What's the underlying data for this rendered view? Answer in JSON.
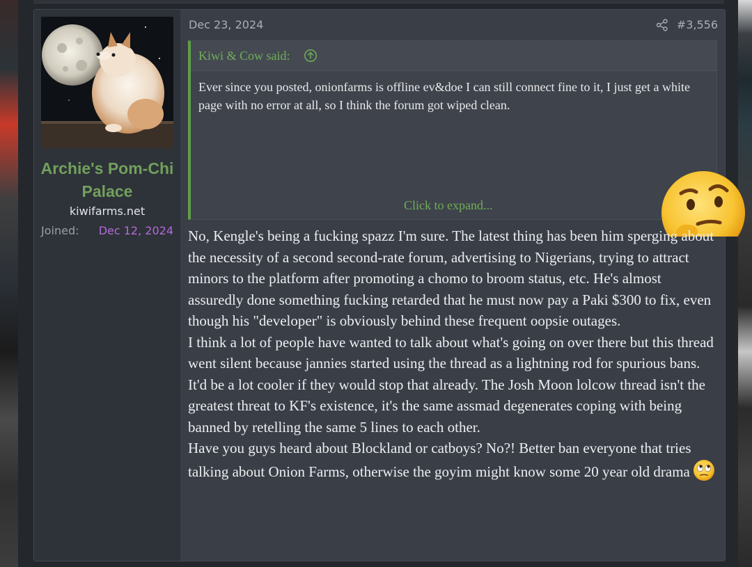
{
  "user": {
    "name": "Archie's Pom-Chi Palace",
    "title": "kiwifarms.net",
    "joined_label": "Joined:",
    "joined_date": "Dec 12, 2024"
  },
  "post": {
    "date": "Dec 23, 2024",
    "number": "#3,556",
    "share_icon": "share-icon"
  },
  "quote": {
    "author": "Kiwi & Cow said:",
    "jump_icon": "arrow-up-circle-icon",
    "text": "Ever since you posted, onionfarms is offline ev&doe I can still connect fine to it, I just get a white page with no error at all, so I think the forum got wiped clean.",
    "expand_label": "Click to expand...",
    "emoji": "thinking-face"
  },
  "message": {
    "paragraphs": [
      "No, Kengle's being a fucking spazz I'm sure. The latest thing has been him sperging about the necessity of a second second-rate forum, advertising to Nigerians, trying to attract minors to the platform after promoting a chomo to broom status, etc. He's almost assuredly done something fucking retarded that he must now pay a Paki $300 to fix, even though his \"developer\" is obviously behind these frequent oopsie outages.",
      "I think a lot of people have wanted to talk about what's going on over there but this thread went silent because jannies started using the thread as a lightning rod for spurious bans. It'd be a lot cooler if they would stop that already. The Josh Moon lolcow thread isn't the greatest threat to KF's existence, it's the same assmad degenerates coping with being banned by retelling the same 5 lines to each other.",
      "Have you guys heard about Blockland or catboys? No?! Better ban everyone that tries talking about Onion Farms, otherwise the goyim might know some 20 year old drama"
    ],
    "trailing_emoji": "eye-roll-face"
  },
  "colors": {
    "accent_green": "#72a05c",
    "joined_purple": "#b56ad9",
    "post_bg": "#3a3e46",
    "user_cell_bg": "#2e3239"
  }
}
